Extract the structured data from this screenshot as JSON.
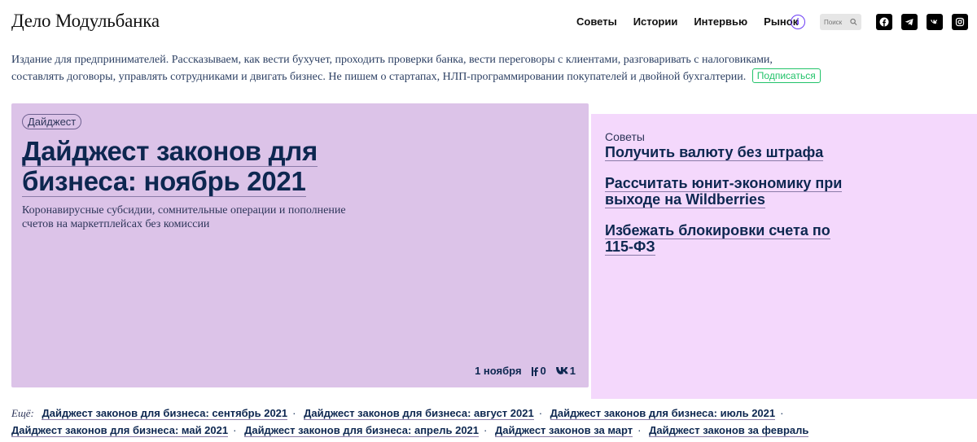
{
  "header": {
    "logo": "Дело Модульбанка",
    "nav": [
      "Советы",
      "Истории",
      "Интервью",
      "Рынок"
    ],
    "info_glyph": "i",
    "search_placeholder": "Поиск",
    "socials": [
      "facebook-icon",
      "telegram-icon",
      "vk-icon",
      "instagram-icon"
    ]
  },
  "intro": {
    "text": "Издание для предпринимателей. Рассказываем, как вести бухучет, проходить проверки банка, вести переговоры с клиентами, разговаривать с налоговиками, составлять договоры, управлять сотрудниками и двигать бизнес. Не пишем о стартапах, НЛП-программировании покупателей и двойной бухгалтерии.",
    "subscribe": "Подписаться"
  },
  "main_article": {
    "tag": "Дайджест",
    "title": "Дайджест законов для бизнеса: ноябрь 2021",
    "lead": "Коронавирусные субсидии, сомнительные операции и пополнение счетов на маркетплейсах без комиссии",
    "date": "1 ноября",
    "fb_count": "0",
    "vk_count": "1"
  },
  "side": {
    "category": "Советы",
    "links": [
      "Получить валюту без штрафа",
      "Рассчитать юнит-экономику при выходе на Wildberries",
      "Избежать блокировки счета по 115-ФЗ"
    ]
  },
  "more": {
    "label": "Ещё:",
    "links": [
      "Дайджест законов для бизнеса: сентябрь 2021",
      "Дайджест законов для бизнеса: август 2021",
      "Дайджест законов для бизнеса: июль 2021",
      "Дайджест законов для бизнеса: май 2021",
      "Дайджест законов для бизнеса: апрель 2021",
      "Дайджест законов за март",
      "Дайджест законов за февраль"
    ],
    "separator": "·"
  },
  "colors": {
    "main_card": "#dcc3e8",
    "side_panel": "#f4d8fc",
    "title": "#0d2750",
    "accent_green": "#22c36a",
    "accent_purple": "#6b3cf5"
  }
}
